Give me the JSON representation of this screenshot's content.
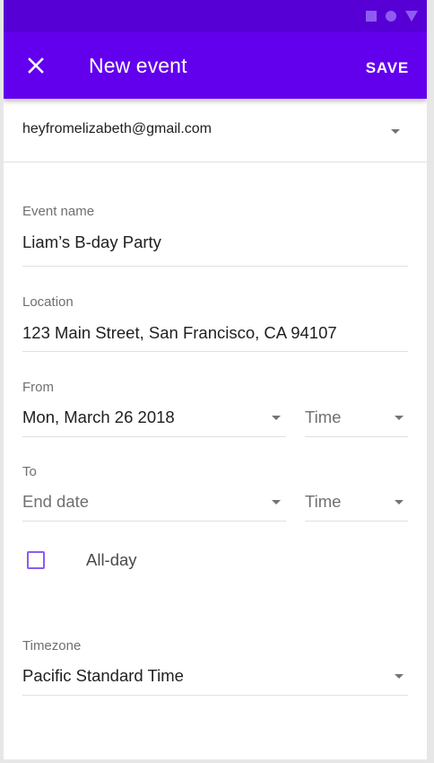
{
  "status_bar": {
    "icons": [
      "square-icon",
      "circle-icon",
      "triangle-icon"
    ]
  },
  "app_bar": {
    "close_icon": "close-icon",
    "title": "New event",
    "save_label": "SAVE"
  },
  "account": {
    "email": "heyfromelizabeth@gmail.com"
  },
  "form": {
    "event_name": {
      "label": "Event name",
      "value": "Liam’s B-day Party"
    },
    "location": {
      "label": "Location",
      "value": "123 Main Street, San Francisco, CA 94107"
    },
    "from": {
      "label": "From",
      "date": "Mon, March 26 2018",
      "time": "Time"
    },
    "to": {
      "label": "To",
      "date": "End date",
      "time": "Time"
    },
    "all_day": {
      "label": "All-day",
      "checked": false
    },
    "timezone": {
      "label": "Timezone",
      "value": "Pacific Standard Time"
    }
  },
  "colors": {
    "status_bar": "#5600d6",
    "app_bar": "#6200ee",
    "checkbox_border": "#8a5cf0",
    "divider": "#e0e0e0"
  }
}
